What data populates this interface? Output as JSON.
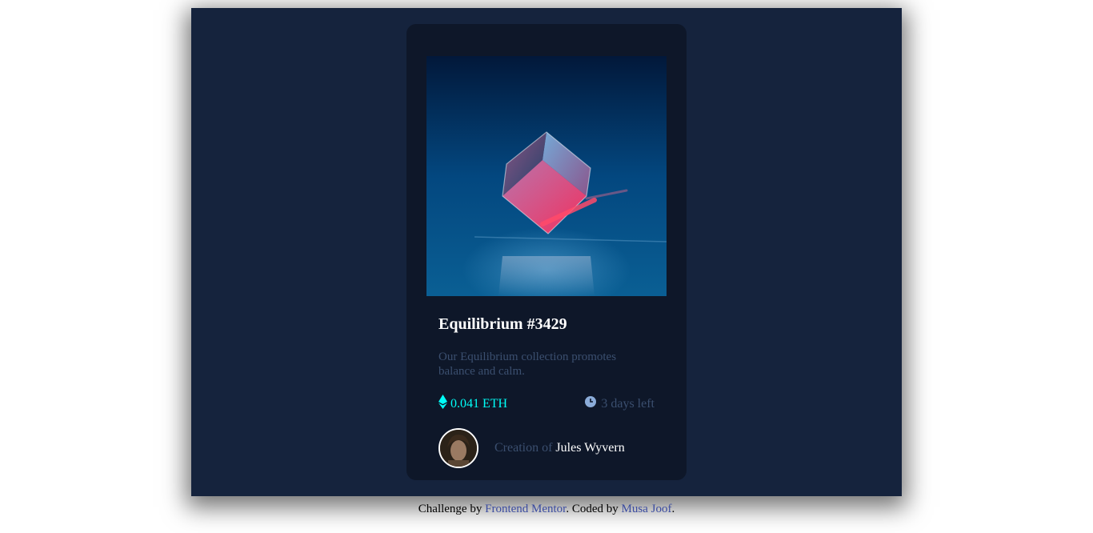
{
  "card": {
    "image_alt": "Equilibrium",
    "title": "Equilibrium #3429",
    "description": "Our Equilibrium collection promotes balance and calm.",
    "price": "0.041 ETH",
    "time_left": "3 days left",
    "creator_prefix": "Creation of",
    "creator_name": "Jules Wyvern"
  },
  "footer": {
    "prefix": "Challenge by",
    "link1": "Frontend Mentor",
    "middle": ". Coded by",
    "link2": "Musa Joof",
    "suffix": "."
  },
  "icons": {
    "price": "ethereum-icon",
    "time": "clock-icon"
  },
  "colors": {
    "page_bg": "#ffffff",
    "stage_bg": "#15233d",
    "card_bg": "#0e1729",
    "cyan": "#00fff8",
    "muted": "#3b4f6f",
    "white": "#ffffff",
    "link": "#3a4ba0"
  }
}
